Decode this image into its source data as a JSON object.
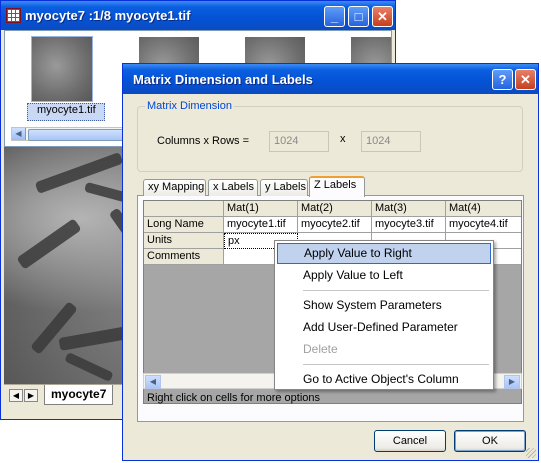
{
  "background_window": {
    "title": "myocyte7 :1/8 myocyte1.tif",
    "caption_buttons": [
      "_",
      "□",
      "✕"
    ],
    "thumbnail_label": "myocyte1.tif",
    "sheet_tab": "myocyte7",
    "nav_arrows": [
      "◀",
      "▶"
    ],
    "scroll_arrows": [
      "◀"
    ]
  },
  "dialog": {
    "title": "Matrix Dimension and Labels",
    "caption_buttons": [
      "?",
      "✕"
    ],
    "group_label": "Matrix Dimension",
    "dimension_label": "Columns  x  Rows  =",
    "x_label": "x",
    "columns_value": "1024",
    "rows_value": "1024",
    "tabs": [
      "xy Mapping",
      "x Labels",
      "y Labels",
      "Z Labels"
    ],
    "active_tab": "Z Labels",
    "grid": {
      "col_headers": [
        "Mat(1)",
        "Mat(2)",
        "Mat(3)",
        "Mat(4)"
      ],
      "row_labels": [
        "Long Name",
        "Units",
        "Comments"
      ],
      "rows": [
        [
          "myocyte1.tif",
          "myocyte2.tif",
          "myocyte3.tif",
          "myocyte4.tif"
        ],
        [
          "px",
          "",
          "",
          ""
        ],
        [
          "",
          "",
          "",
          ""
        ]
      ]
    },
    "scroll_arrows": [
      "◀",
      "▶"
    ],
    "hint": "Right click on cells for more options",
    "cancel_label": "Cancel",
    "ok_label": "OK"
  },
  "context_menu": {
    "items": [
      {
        "label": "Apply Value to Right",
        "highlighted": true,
        "disabled": false
      },
      {
        "label": "Apply Value to Left",
        "highlighted": false,
        "disabled": false
      },
      {
        "label": "Show System Parameters",
        "highlighted": false,
        "disabled": false
      },
      {
        "label": "Add User-Defined Parameter",
        "highlighted": false,
        "disabled": false
      },
      {
        "label": "Delete",
        "highlighted": false,
        "disabled": true
      },
      {
        "label": "Go to Active Object's Column",
        "highlighted": false,
        "disabled": false
      }
    ]
  },
  "colors": {
    "title_bar": "#0553d6",
    "menu_highlight": "#c1d2ee",
    "group_label": "#0046d5"
  }
}
